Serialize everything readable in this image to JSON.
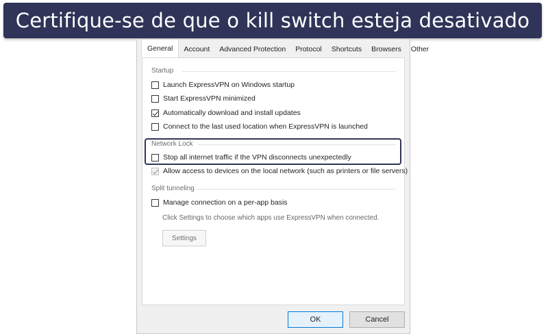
{
  "banner": {
    "text": "Certifique-se de que o kill switch esteja desativado"
  },
  "tabs": [
    "General",
    "Account",
    "Advanced Protection",
    "Protocol",
    "Shortcuts",
    "Browsers",
    "Other"
  ],
  "startup": {
    "title": "Startup",
    "options": [
      {
        "label": "Launch ExpressVPN on Windows startup",
        "checked": false
      },
      {
        "label": "Start ExpressVPN minimized",
        "checked": false
      },
      {
        "label": "Automatically download and install updates",
        "checked": true
      },
      {
        "label": "Connect to the last used location when ExpressVPN is launched",
        "checked": false
      }
    ]
  },
  "network_lock": {
    "title": "Network Lock",
    "options": [
      {
        "label": "Stop all internet traffic if the VPN disconnects unexpectedly",
        "checked": false
      },
      {
        "label": "Allow access to devices on the local network (such as printers or file servers)",
        "checked": true,
        "disabled": true
      }
    ]
  },
  "split_tunneling": {
    "title": "Split tunneling",
    "option": {
      "label": "Manage connection on a per-app basis",
      "checked": false
    },
    "hint": "Click Settings to choose which apps use ExpressVPN when connected.",
    "settings_label": "Settings"
  },
  "footer": {
    "ok_label": "OK",
    "cancel_label": "Cancel"
  },
  "colors": {
    "banner_bg": "#2f3458",
    "highlight_border": "#2f3458",
    "ok_border": "#0078d7"
  }
}
